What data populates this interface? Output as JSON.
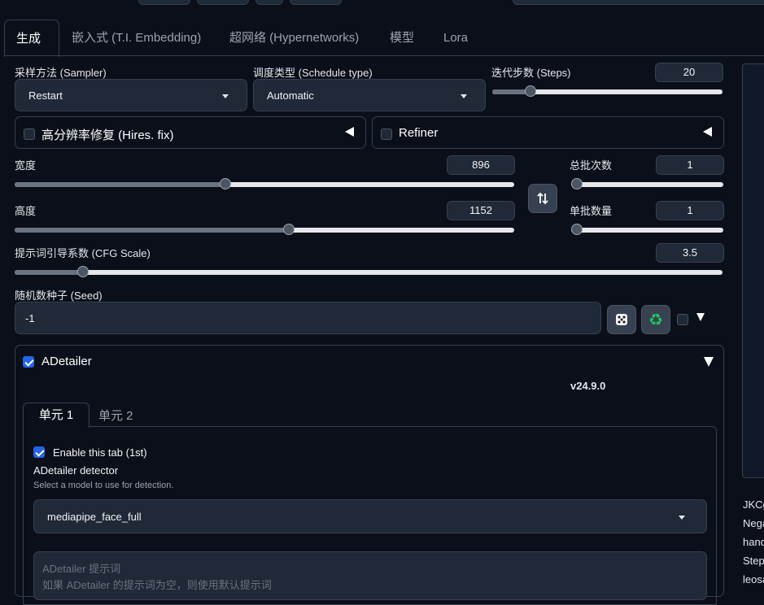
{
  "tabs": [
    "生成",
    "嵌入式 (T.I. Embedding)",
    "超网络 (Hypernetworks)",
    "模型",
    "Lora"
  ],
  "sampler": {
    "label": "采样方法 (Sampler)",
    "value": "Restart"
  },
  "schedule": {
    "label": "调度类型 (Schedule type)",
    "value": "Automatic"
  },
  "steps": {
    "label": "迭代步数 (Steps)",
    "value": "20",
    "level": 0.15
  },
  "hires": {
    "label": "高分辨率修复 (Hires. fix)",
    "checked": false
  },
  "refiner": {
    "label": "Refiner",
    "checked": false
  },
  "width": {
    "label": "宽度",
    "value": "896",
    "level": 0.42
  },
  "height": {
    "label": "高度",
    "value": "1152",
    "level": 0.55
  },
  "swap_icon": "swap-icon",
  "batch_count": {
    "label": "总批次数",
    "value": "1",
    "level": 0.0
  },
  "batch_size": {
    "label": "单批数量",
    "value": "1",
    "level": 0.0
  },
  "cfg": {
    "label": "提示词引导系数 (CFG Scale)",
    "value": "3.5",
    "level": 0.09
  },
  "seed": {
    "label": "随机数种子 (Seed)",
    "value": "-1"
  },
  "adetailer": {
    "label": "ADetailer",
    "version": "v24.9.0",
    "tabs": [
      "单元 1",
      "单元 2"
    ],
    "enable_label": "Enable this tab (1st)",
    "detector_label": "ADetailer detector",
    "detector_hint": "Select a model to use for detection.",
    "detector_value": "mediapipe_face_full",
    "prompt_label": "ADetailer 提示词",
    "prompt_placeholder": "如果 ADetailer 的提示词为空，则使用默认提示词"
  },
  "side_text": [
    "JKCg",
    "Nega",
    "hand",
    "Step",
    "leosa"
  ],
  "colors": {
    "accent": "#2563eb",
    "bg": "#0b0f19",
    "panel": "#1f2937",
    "recycle": "#22c55e"
  }
}
